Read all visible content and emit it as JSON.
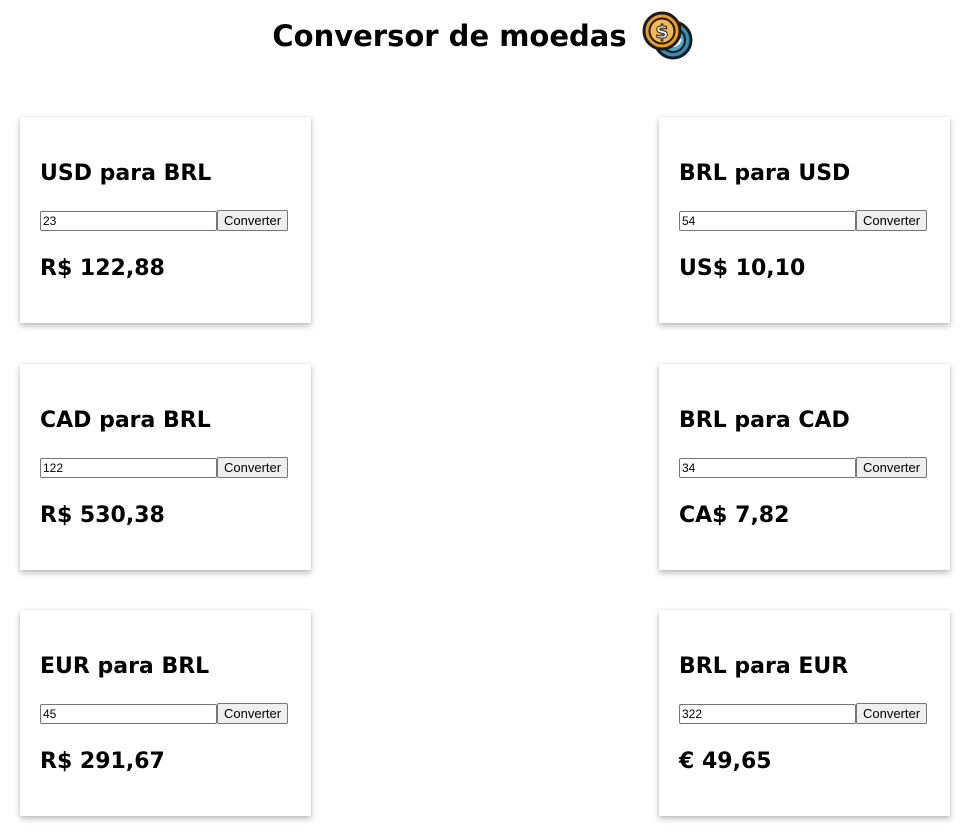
{
  "header": {
    "title": "Conversor de moedas",
    "icon": "coins-exchange-icon",
    "colors": {
      "gold": "#F29A1F",
      "blue": "#2E8FB8",
      "outline": "#1a1a1a"
    }
  },
  "cards": [
    {
      "title": "USD para BRL",
      "input_value": "23",
      "button_label": "Converter",
      "result": "R$ 122,88"
    },
    {
      "title": "BRL para USD",
      "input_value": "54",
      "button_label": "Converter",
      "result": "US$ 10,10"
    },
    {
      "title": "CAD para BRL",
      "input_value": "122",
      "button_label": "Converter",
      "result": "R$ 530,38"
    },
    {
      "title": "BRL para CAD",
      "input_value": "34",
      "button_label": "Converter",
      "result": "CA$ 7,82"
    },
    {
      "title": "EUR para BRL",
      "input_value": "45",
      "button_label": "Converter",
      "result": "R$ 291,67"
    },
    {
      "title": "BRL para EUR",
      "input_value": "322",
      "button_label": "Converter",
      "result": "€ 49,65"
    }
  ]
}
